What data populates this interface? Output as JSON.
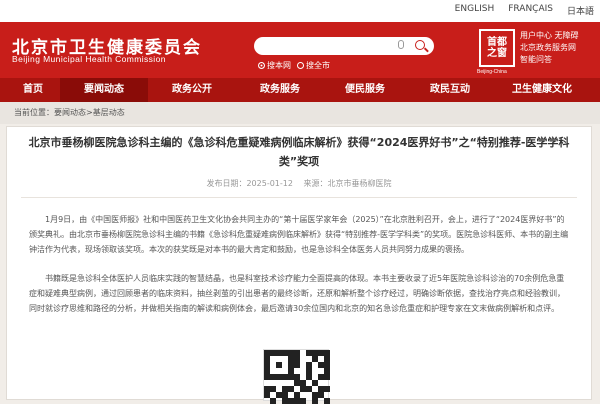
{
  "top_langs": [
    "ENGLISH",
    "FRANÇAIS",
    "日本語"
  ],
  "header": {
    "title": "北京市卫生健康委员会",
    "subtitle": "Beijing Municipal Health Commission",
    "search": {
      "placeholder": "",
      "scopes": [
        "搜本网",
        "搜全市"
      ]
    },
    "logo_text": "首都之窗",
    "logo_caption": "Beijing-China",
    "service_links": [
      "用户中心  无障碍",
      "北京政务服务网",
      "智能问答"
    ]
  },
  "nav": [
    "首页",
    "要闻动态",
    "政务公开",
    "政务服务",
    "便民服务",
    "政民互动",
    "卫生健康文化"
  ],
  "nav_active_index": 1,
  "breadcrumb": "当前位置：要闻动态>基层动态",
  "article": {
    "title": "北京市垂杨柳医院急诊科主编的《急诊科危重疑难病例临床解析》获得“2024医界好书”之“特别推荐-医学学科类”奖项",
    "date": "发布日期：2025-01-12",
    "source": "来源：北京市垂杨柳医院",
    "para1": "1月9日，由《中国医师报》社和中国医药卫生文化协会共同主办的“第十届医学家年会（2025）”在北京胜利召开，会上，进行了“2024医界好书”的颁奖典礼。由北京市垂杨柳医院急诊科主编的书籍《急诊科危重疑难病例临床解析》获得“特别推荐-医学学科类”的奖项。医院急诊科医师、本书的副主编钟洁作为代表，现场领取该奖项。本次的获奖既是对本书的最大肯定和鼓励，也是急诊科全体医务人员共同努力成果的褒扬。",
    "para2": "书籍既是急诊科全体医护人员临床实践的智慧结晶，也是科室技术诊疗能力全面提高的体现。本书主要收录了近5年医院急诊科诊治的70余例危急重症和疑难典型病例，通过回顾患者的临床资料，抽丝剥茧的引出患者的最终诊断，还原和解析整个诊疗经过，明确诊断依据，查找治疗亮点和经验教训，同时就诊疗思维和路径的分析，并做相关指南的解读和病例体会，最后邀请30余位国内和北京的知名急诊危重症和护理专家在文末做病例解析和点评。"
  },
  "colors": {
    "brand_red": "#c81e1a",
    "nav_red": "#a9140f",
    "nav_active": "#8a0c08",
    "page_bg": "#f1ede8"
  },
  "icons": {
    "search": "search-icon",
    "mic": "microphone-icon",
    "logo": "capital-window-logo",
    "qr": "qr-code"
  }
}
